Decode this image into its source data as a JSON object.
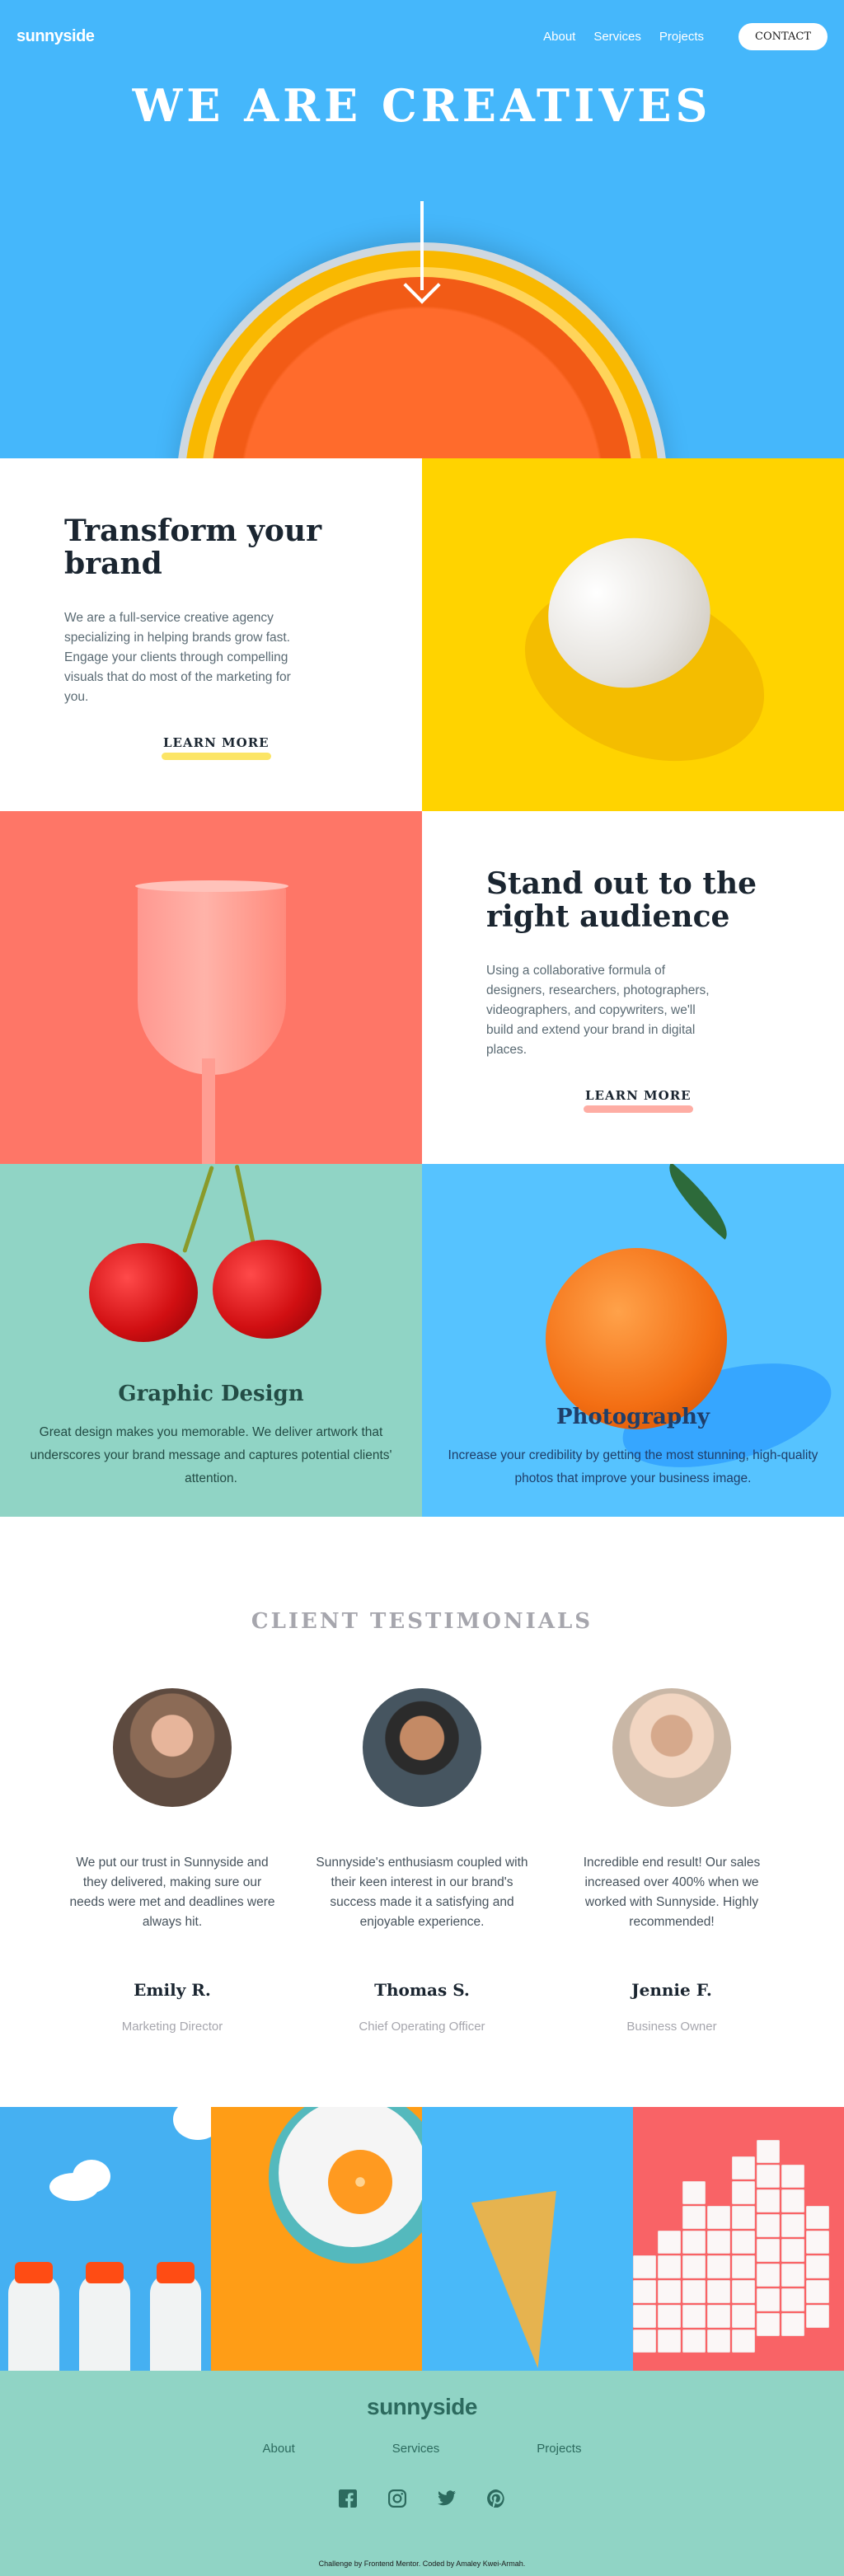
{
  "nav": {
    "logo": "sunnyside",
    "links": [
      "About",
      "Services",
      "Projects"
    ],
    "contact": "CONTACT"
  },
  "hero": {
    "title": "WE ARE CREATIVES"
  },
  "features": [
    {
      "title": "Transform your brand",
      "body": "We are a full-service creative agency specializing in helping brands grow fast. Engage your clients through compelling visuals that do most of the marketing for you.",
      "cta": "LEARN MORE",
      "accent": "#fad400"
    },
    {
      "title": "Stand out to the right audience",
      "body": "Using a collaborative formula of designers, researchers, photographers, videographers, and copywriters, we'll build and extend your brand in digital places.",
      "cta": "LEARN MORE",
      "accent": "#fe7667"
    }
  ],
  "services": [
    {
      "title": "Graphic Design",
      "body": "Great design makes you memorable. We deliver artwork that underscores your brand message and captures potential clients' attention."
    },
    {
      "title": "Photography",
      "body": "Increase your credibility by getting the most stunning, high-quality photos that improve your business image."
    }
  ],
  "testimonials": {
    "heading": "CLIENT TESTIMONIALS",
    "items": [
      {
        "quote": "We put our trust in Sunnyside and they delivered, making sure our needs were met and deadlines were always hit.",
        "name": "Emily R.",
        "role": "Marketing Director"
      },
      {
        "quote": "Sunnyside's enthusiasm coupled with their keen interest in our brand's success made it a satisfying and enjoyable experience.",
        "name": "Thomas S.",
        "role": "Chief Operating Officer"
      },
      {
        "quote": "Incredible end result! Our sales increased over 400% when we worked with Sunnyside. Highly recommended!",
        "name": "Jennie F.",
        "role": "Business Owner"
      }
    ]
  },
  "footer": {
    "logo": "sunnyside",
    "links": [
      "About",
      "Services",
      "Projects"
    ],
    "socials": [
      "facebook-icon",
      "instagram-icon",
      "twitter-icon",
      "pinterest-icon"
    ],
    "attribution": "Challenge by Frontend Mentor. Coded by Amaley Kwei-Armah."
  },
  "colors": {
    "hero_blue": "#45b7fb",
    "yellow": "#fad400",
    "coral": "#fe7667",
    "teal": "#90d4c5",
    "dark_teal": "#2c6a5e"
  }
}
